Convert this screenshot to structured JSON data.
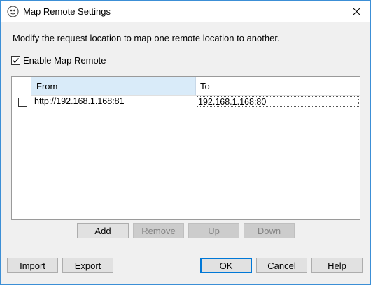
{
  "window": {
    "title": "Map Remote Settings"
  },
  "description": "Modify the request location to map one remote location to another.",
  "enable_map_remote": {
    "label": "Enable Map Remote",
    "checked": true
  },
  "table": {
    "columns": [
      "From",
      "To"
    ],
    "rows": [
      {
        "checked": false,
        "from": "http://192.168.1.168:81",
        "to": "192.168.1.168:80"
      }
    ]
  },
  "table_buttons": {
    "add": "Add",
    "remove": "Remove",
    "up": "Up",
    "down": "Down"
  },
  "footer_buttons": {
    "import": "Import",
    "export": "Export",
    "ok": "OK",
    "cancel": "Cancel",
    "help": "Help"
  },
  "colors": {
    "header_selected": "#d9ebf9",
    "accent": "#0078d7"
  }
}
